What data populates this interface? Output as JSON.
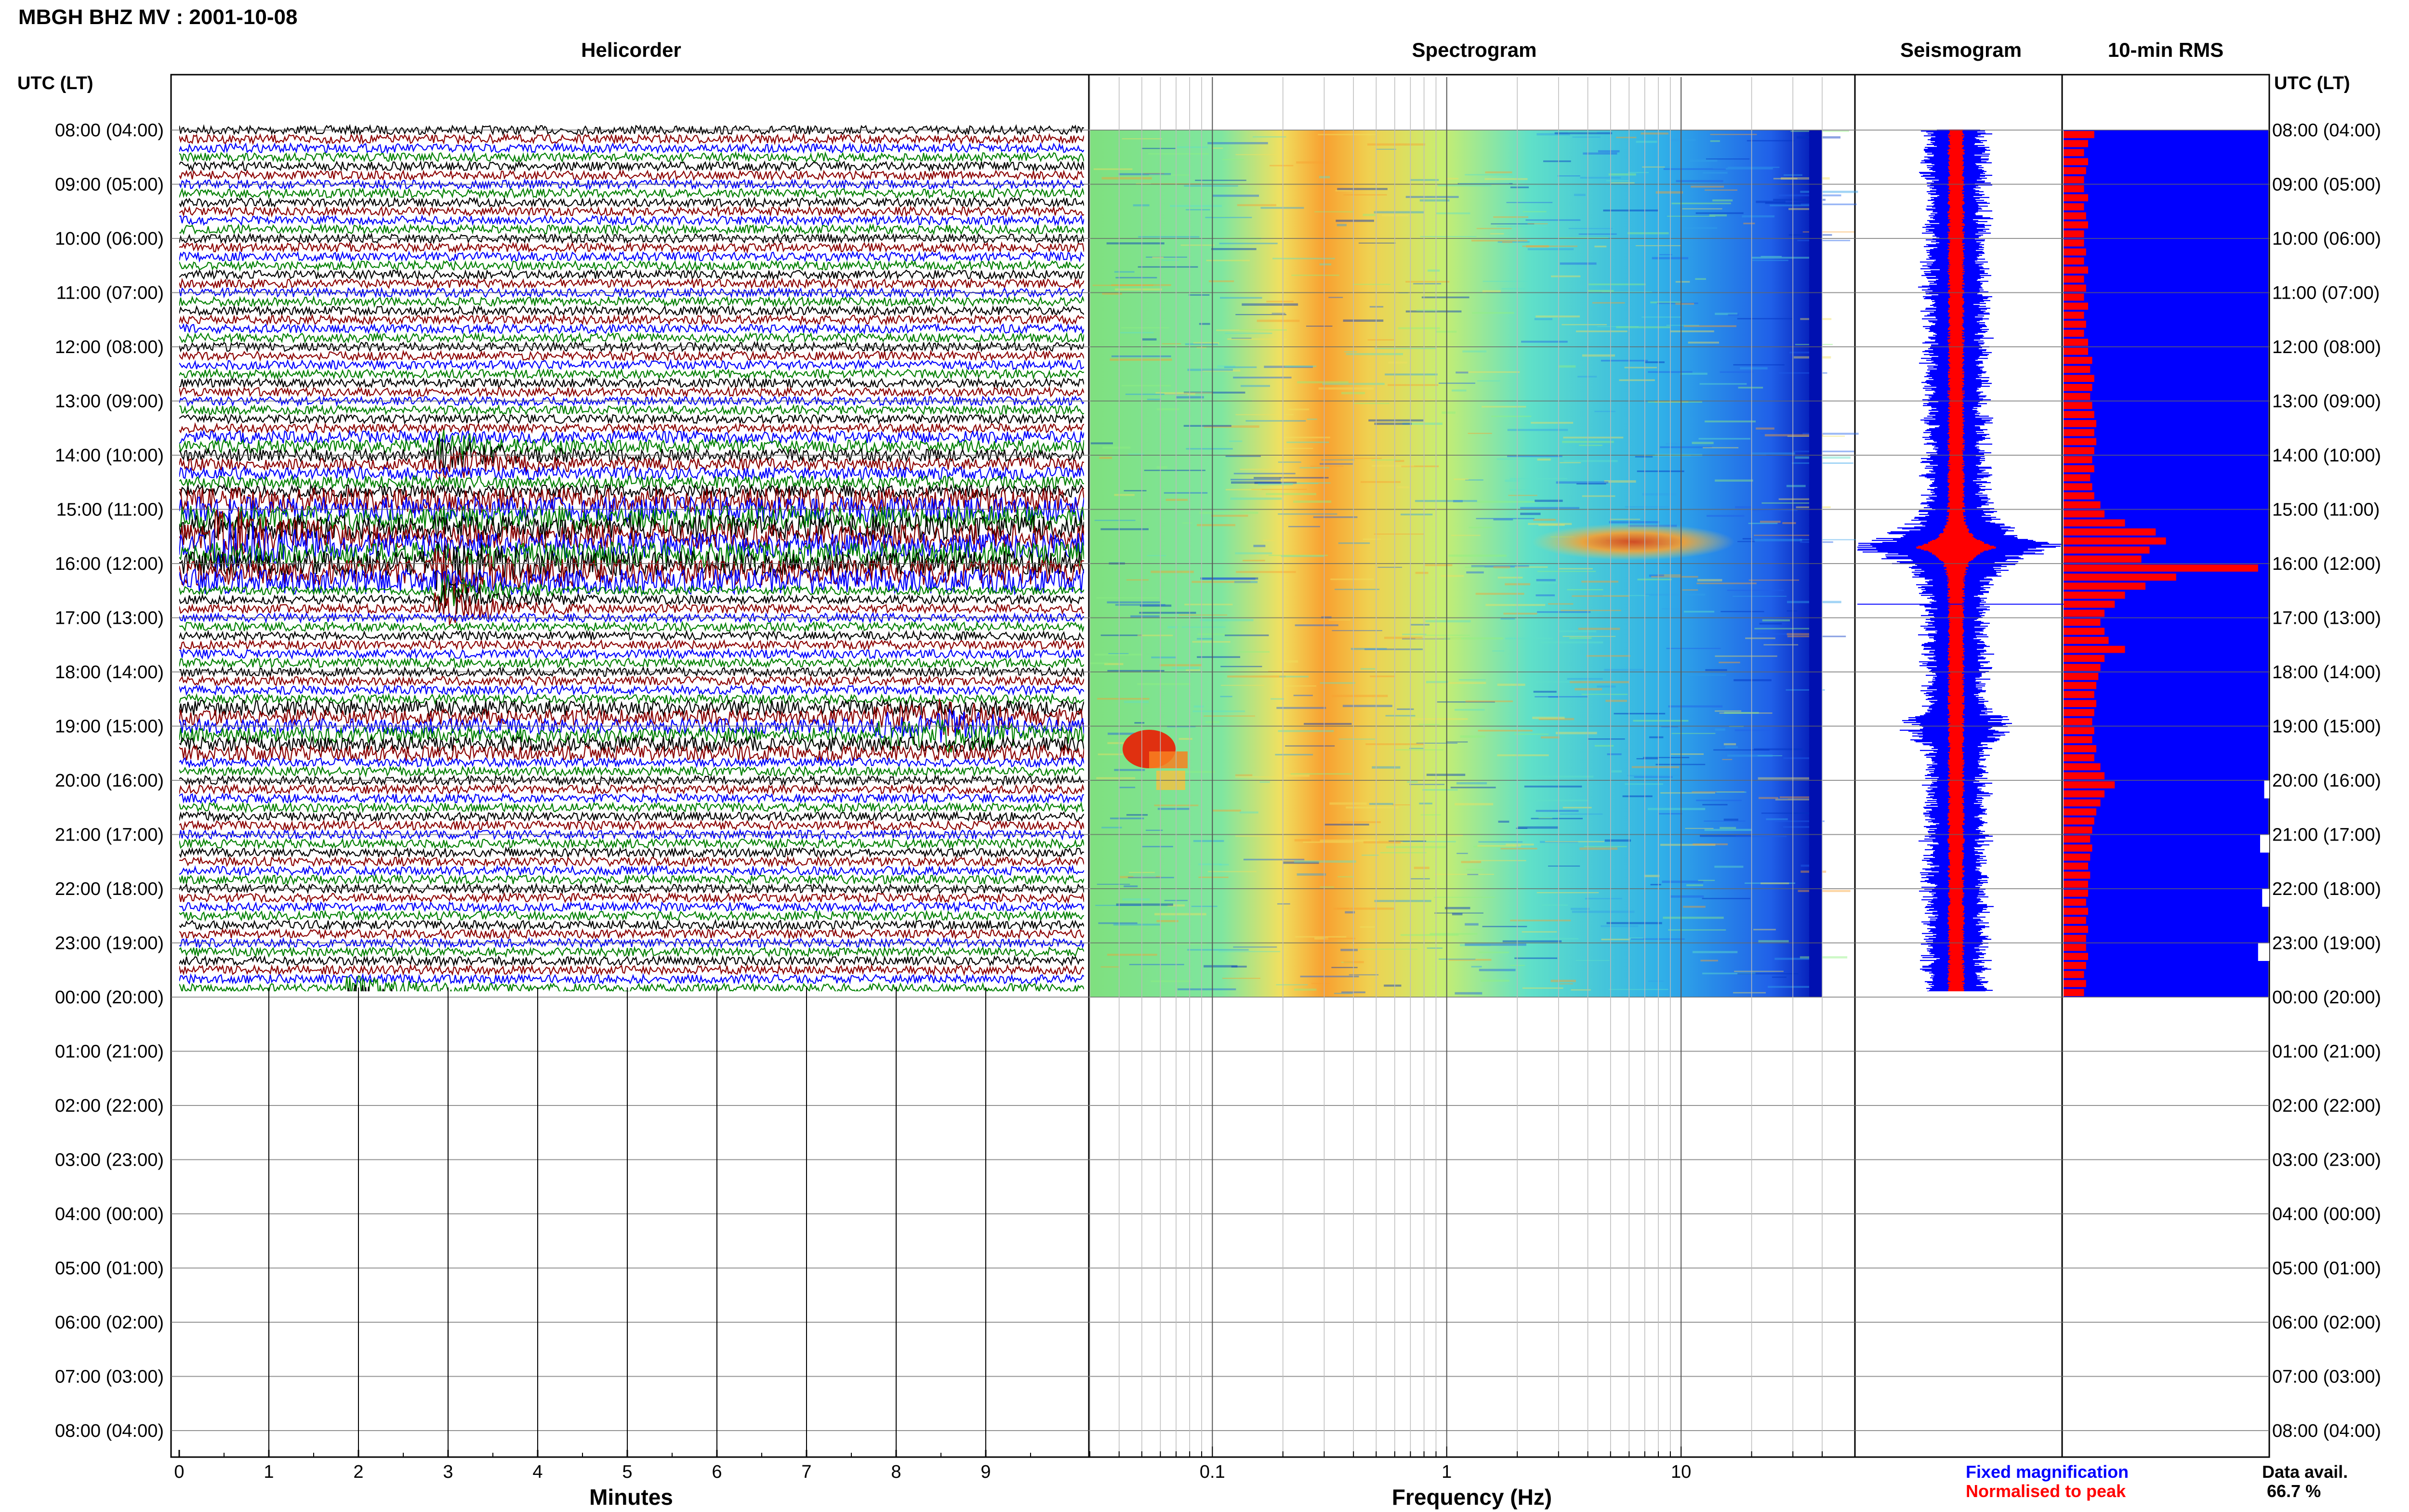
{
  "header": {
    "station_title": "MBGH BHZ MV : 2001-10-08",
    "time_axis_label": "UTC (LT)"
  },
  "panels": {
    "helicorder": {
      "title": "Helicorder",
      "xlabel": "Minutes"
    },
    "spectrogram": {
      "title": "Spectrogram",
      "xlabel": "Frequency (Hz)"
    },
    "seismogram": {
      "title": "Seismogram"
    },
    "rms": {
      "title": "10-min RMS"
    }
  },
  "legend": {
    "fixed_label": "Fixed magnification",
    "fixed_color": "#0000ff",
    "normalised_label": "Normalised to peak",
    "normalised_color": "#ff0000"
  },
  "availability": {
    "label": "Data avail.",
    "value": "66.7 %"
  },
  "time_ticks": [
    "08:00 (04:00)",
    "09:00 (05:00)",
    "10:00 (06:00)",
    "11:00 (07:00)",
    "12:00 (08:00)",
    "13:00 (09:00)",
    "14:00 (10:00)",
    "15:00 (11:00)",
    "16:00 (12:00)",
    "17:00 (13:00)",
    "18:00 (14:00)",
    "19:00 (15:00)",
    "20:00 (16:00)",
    "21:00 (17:00)",
    "22:00 (18:00)",
    "23:00 (19:00)",
    "00:00 (20:00)",
    "01:00 (21:00)",
    "02:00 (22:00)",
    "03:00 (23:00)",
    "04:00 (00:00)",
    "05:00 (01:00)",
    "06:00 (02:00)",
    "07:00 (03:00)",
    "08:00 (04:00)"
  ],
  "chart_data": [
    {
      "type": "line",
      "panel": "helicorder",
      "title": "Helicorder",
      "xlabel": "Minutes",
      "x_ticks": [
        "0",
        "1",
        "2",
        "3",
        "4",
        "5",
        "6",
        "7",
        "8",
        "9"
      ],
      "xlim": [
        0,
        10
      ],
      "ylim_hours": [
        0,
        24
      ],
      "trace_colors": [
        "#000000",
        "#8b0000",
        "#0000ff",
        "#008000"
      ],
      "rows_per_hour": 6,
      "rows_with_data": 97,
      "events": [
        {
          "hour": 6,
          "minute": 3.0,
          "amplitude": 2.0
        },
        {
          "hour": 7.6,
          "minute": 0.5,
          "amplitude": 4.0
        },
        {
          "hour": 8.1,
          "minute": 3.0,
          "amplitude": 3.0
        },
        {
          "hour": 8.7,
          "minute": 3.0,
          "amplitude": 2.5
        },
        {
          "hour": 11.0,
          "minute": 7.9,
          "amplitude": 1.5
        },
        {
          "hour": 11.0,
          "minute": 8.6,
          "amplitude": 1.5
        },
        {
          "hour": 16.0,
          "minute": 2.0,
          "amplitude": 1.5
        }
      ]
    },
    {
      "type": "heatmap",
      "panel": "spectrogram",
      "title": "Spectrogram",
      "xlabel": "Frequency (Hz)",
      "x_scale": "log",
      "xlim": [
        0.03,
        40
      ],
      "x_ticks": [
        0.1,
        1,
        10
      ],
      "x_tick_labels": [
        "0.1",
        "1",
        "10"
      ],
      "ylim_hours": [
        0,
        24
      ],
      "hours_with_data": 16,
      "peak_bands": [
        {
          "label": "microseism",
          "freq_low": 0.2,
          "freq_high": 0.45
        },
        {
          "label": "event",
          "freq_low": 2.0,
          "freq_high": 8.0,
          "hour": 7.6
        },
        {
          "label": "low-frequency event",
          "freq_low": 0.035,
          "freq_high": 0.06,
          "hour": 11.2
        }
      ]
    },
    {
      "type": "line",
      "panel": "seismogram",
      "title": "Seismogram",
      "series": [
        {
          "name": "Fixed magnification",
          "color": "#0000ff"
        },
        {
          "name": "Normalised to peak",
          "color": "#ff0000"
        }
      ],
      "peak_hour": 7.7
    },
    {
      "type": "bar",
      "panel": "rms",
      "title": "10-min RMS",
      "bin_minutes": 10,
      "series": [
        {
          "name": "Fixed magnification",
          "color": "#0000ff"
        },
        {
          "name": "Normalised to peak",
          "color": "#ff0000"
        }
      ],
      "normalised_values": [
        0.15,
        0.12,
        0.1,
        0.12,
        0.11,
        0.1,
        0.1,
        0.12,
        0.1,
        0.11,
        0.12,
        0.1,
        0.1,
        0.11,
        0.1,
        0.12,
        0.1,
        0.11,
        0.1,
        0.12,
        0.1,
        0.11,
        0.1,
        0.12,
        0.12,
        0.14,
        0.13,
        0.15,
        0.14,
        0.13,
        0.14,
        0.15,
        0.16,
        0.15,
        0.16,
        0.15,
        0.14,
        0.15,
        0.13,
        0.14,
        0.15,
        0.18,
        0.2,
        0.3,
        0.45,
        0.5,
        0.42,
        0.38,
        0.95,
        0.55,
        0.4,
        0.3,
        0.25,
        0.2,
        0.18,
        0.2,
        0.22,
        0.3,
        0.2,
        0.18,
        0.17,
        0.16,
        0.15,
        0.16,
        0.15,
        0.14,
        0.15,
        0.14,
        0.16,
        0.15,
        0.18,
        0.2,
        0.25,
        0.2,
        0.18,
        0.16,
        0.15,
        0.14,
        0.13,
        0.14,
        0.13,
        0.12,
        0.13,
        0.12,
        0.12,
        0.11,
        0.12,
        0.11,
        0.12,
        0.11,
        0.11,
        0.12,
        0.11,
        0.1,
        0.11,
        0.1
      ],
      "fixed_values_last_hours": [
        0.98,
        0.96,
        0.97,
        0.95
      ]
    }
  ]
}
